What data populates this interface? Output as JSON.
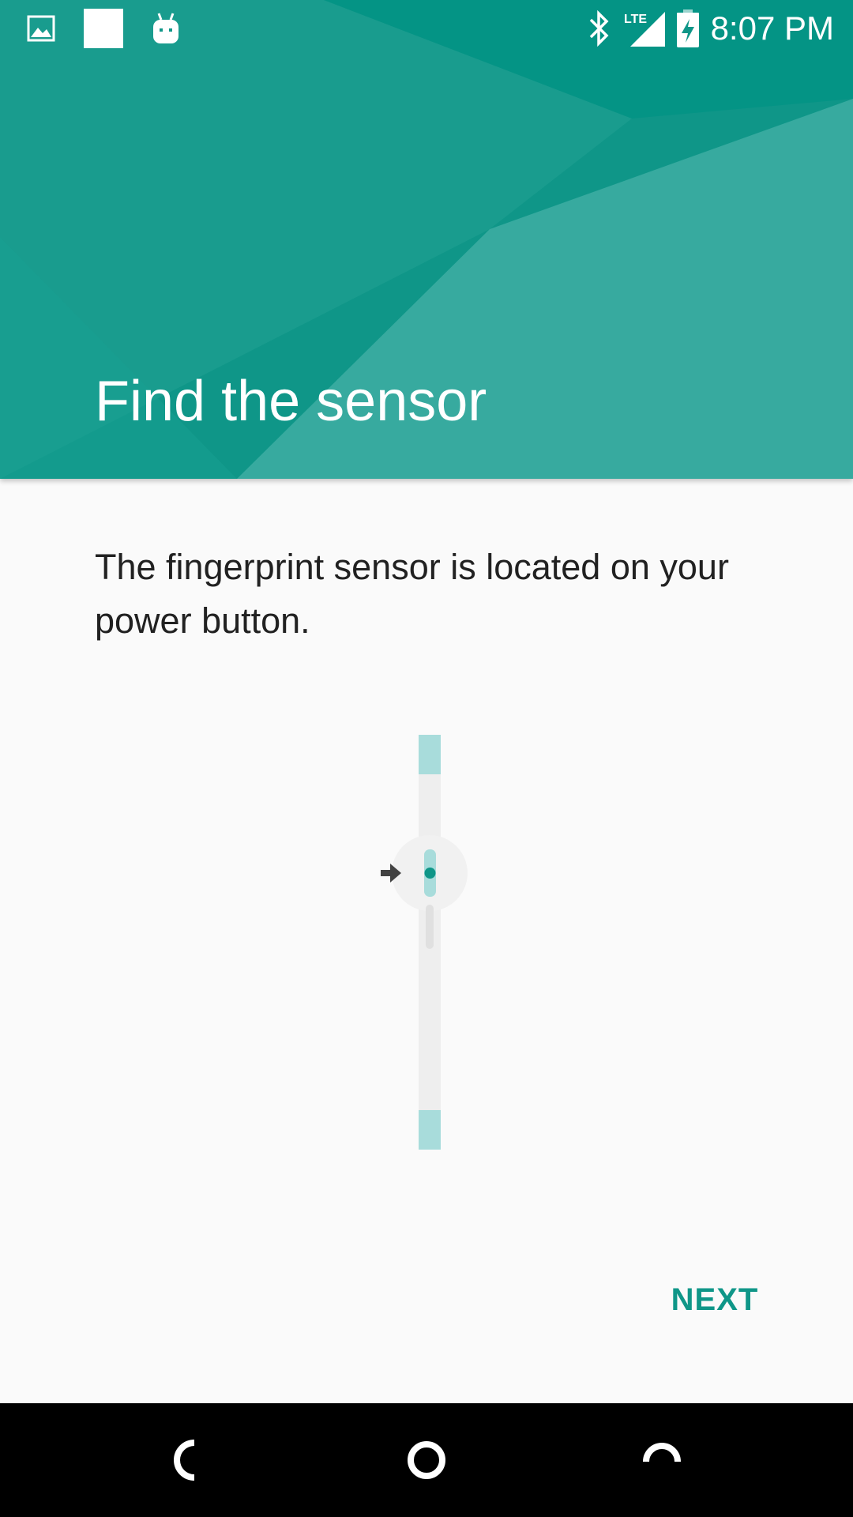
{
  "status_bar": {
    "left_icons": [
      "image-icon",
      "white-square-icon",
      "android-robot-icon"
    ],
    "right_icons": [
      "bluetooth-icon",
      "lte-signal-icon",
      "battery-charging-icon"
    ],
    "network_label": "LTE",
    "time": "8:07 PM"
  },
  "header": {
    "title": "Find the sensor"
  },
  "body": {
    "description": "The fingerprint sensor is located on your power button."
  },
  "illustration": {
    "arrow_icon": "arrow-right-icon",
    "sensor_icon": "fingerprint-sensor-dot-icon"
  },
  "actions": {
    "next_label": "NEXT"
  },
  "nav_bar": {
    "buttons": [
      "back-icon",
      "home-icon",
      "recents-icon"
    ]
  },
  "colors": {
    "accent": "#0f9688",
    "header_light": "#4db6ac",
    "sensor_tint": "#a8dcdb",
    "background": "#fafafa",
    "text": "#212121"
  }
}
